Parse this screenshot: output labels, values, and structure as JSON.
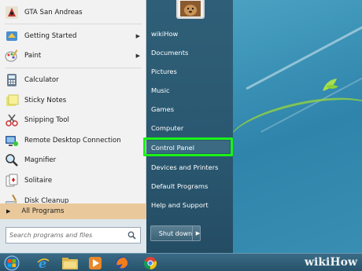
{
  "start_menu": {
    "programs": [
      {
        "label": "GTA San Andreas",
        "icon": "gta-icon",
        "has_arrow": false
      },
      {
        "label": "Getting Started",
        "icon": "getting-started-icon",
        "has_arrow": true
      },
      {
        "label": "Paint",
        "icon": "paint-icon",
        "has_arrow": true
      },
      {
        "label": "Calculator",
        "icon": "calculator-icon",
        "has_arrow": false
      },
      {
        "label": "Sticky Notes",
        "icon": "sticky-notes-icon",
        "has_arrow": false
      },
      {
        "label": "Snipping Tool",
        "icon": "snipping-tool-icon",
        "has_arrow": false
      },
      {
        "label": "Remote Desktop Connection",
        "icon": "remote-desktop-icon",
        "has_arrow": false
      },
      {
        "label": "Magnifier",
        "icon": "magnifier-icon",
        "has_arrow": false
      },
      {
        "label": "Solitaire",
        "icon": "solitaire-icon",
        "has_arrow": false
      },
      {
        "label": "Disk Cleanup",
        "icon": "disk-cleanup-icon",
        "has_arrow": false
      }
    ],
    "all_programs": "All Programs",
    "search_placeholder": "Search programs and files",
    "right_links": [
      "wikiHow",
      "Documents",
      "Pictures",
      "Music",
      "Games",
      "Computer",
      "Control Panel",
      "Devices and Printers",
      "Default Programs",
      "Help and Support"
    ],
    "shutdown_label": "Shut down",
    "highlight_color": "#1bf216"
  },
  "taskbar": {
    "items": [
      "start-orb-icon",
      "internet-explorer-icon",
      "file-explorer-icon",
      "media-player-icon",
      "firefox-icon",
      "chrome-icon"
    ]
  },
  "watermark": "wikiHow"
}
